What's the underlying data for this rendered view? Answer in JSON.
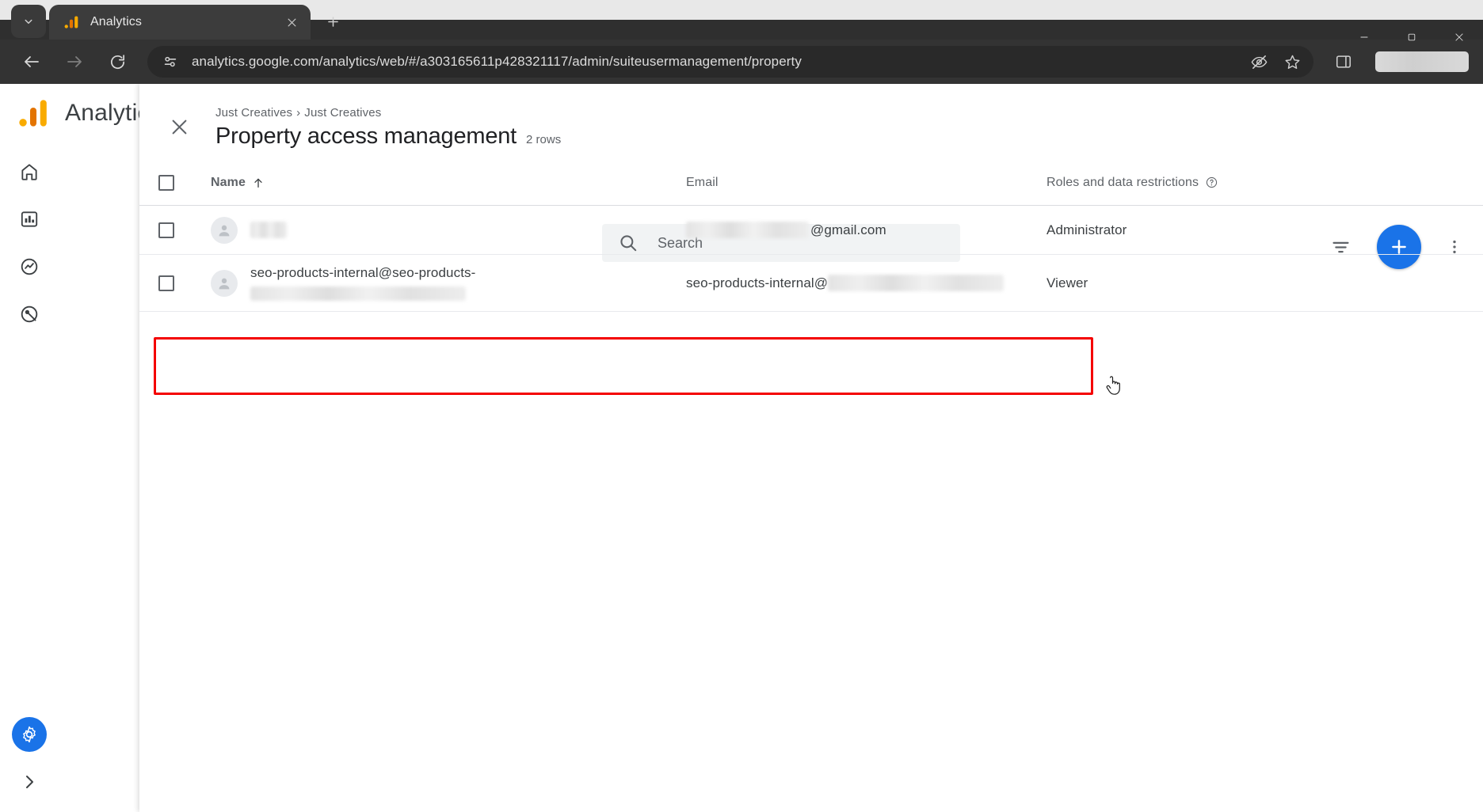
{
  "browser": {
    "tab": {
      "title": "Analytics",
      "favicon": "analytics-favicon-icon"
    },
    "new_tab_label": "+",
    "window_controls": {
      "minimize": "–",
      "maximize": "❐",
      "close": "✕"
    },
    "nav": {
      "back": "back-arrow-icon",
      "forward": "forward-arrow-icon",
      "reload": "reload-icon"
    },
    "omnibox": {
      "url": "analytics.google.com/analytics/web/#/a303165611p428321117/admin/suiteusermanagement/property",
      "site_info_icon": "tune-site-settings-icon",
      "tracking_icon": "eye-off-icon",
      "bookmark_icon": "star-icon",
      "sidepanel_icon": "side-panel-icon"
    }
  },
  "ga_shell": {
    "wordmark": "Analytics",
    "logo_icon": "analytics-logo-icon",
    "rail": [
      {
        "name": "home",
        "icon": "home-icon"
      },
      {
        "name": "reports",
        "icon": "bar-chart-icon"
      },
      {
        "name": "explore",
        "icon": "explore-icon"
      },
      {
        "name": "advertising",
        "icon": "advertising-icon"
      }
    ],
    "settings_icon": "gear-icon",
    "expand_icon": "chevron-right-icon"
  },
  "dialog": {
    "close_icon": "close-icon",
    "breadcrumb": {
      "account": "Just Creatives",
      "separator": "›",
      "property": "Just Creatives"
    },
    "title": "Property access management",
    "row_count": "2 rows",
    "search": {
      "placeholder": "Search",
      "value": "",
      "icon": "search-icon"
    },
    "filter_icon": "filter-icon",
    "add_button": {
      "icon": "plus-icon",
      "label": "+"
    },
    "more_icon": "more-vert-icon"
  },
  "table": {
    "headers": {
      "name": "Name",
      "sort_icon": "arrow-up-icon",
      "email": "Email",
      "roles": "Roles and data restrictions",
      "help_icon": "help-circle-icon"
    },
    "rows": [
      {
        "name": "",
        "name_redacted": true,
        "email_prefix": "",
        "email_redacted": true,
        "email_suffix": "@gmail.com",
        "role": "Administrator",
        "avatar_icon": "person-avatar-icon",
        "highlighted": false
      },
      {
        "name": "seo-products-internal@seo-products-",
        "name_redacted": true,
        "email_prefix": "seo-products-internal@",
        "email_redacted": true,
        "email_suffix": "",
        "role": "Viewer",
        "avatar_icon": "person-avatar-icon",
        "highlighted": true
      }
    ]
  },
  "annotation": {
    "highlight_color": "#f40000",
    "shape": "rectangle"
  },
  "cursor": {
    "type": "pointer-hand"
  }
}
